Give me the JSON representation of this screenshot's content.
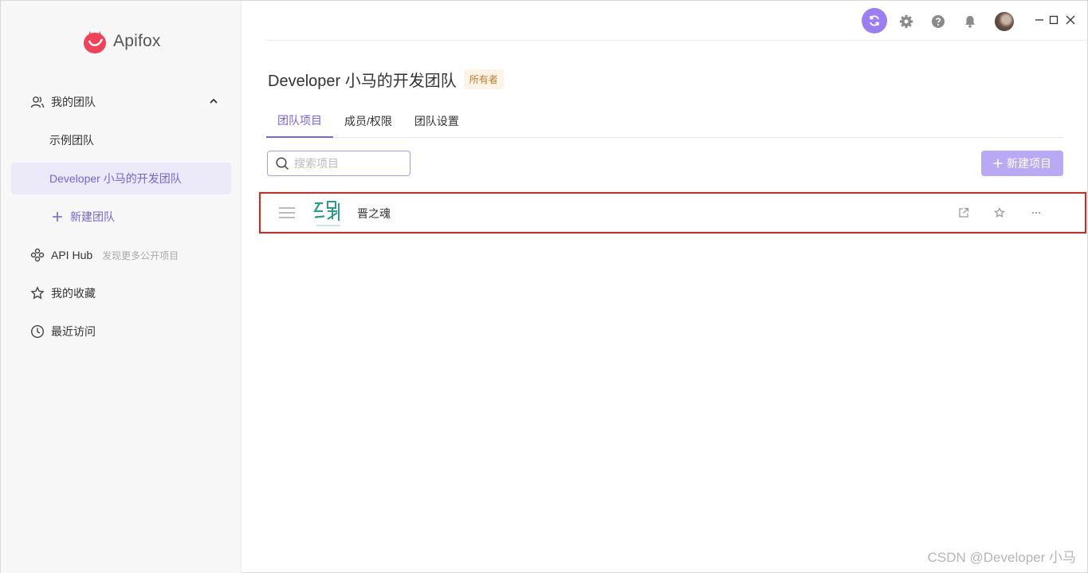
{
  "app": {
    "name": "Apifox"
  },
  "sidebar": {
    "items": [
      {
        "label": "我的团队"
      },
      {
        "label": "示例团队"
      },
      {
        "label": "Developer 小马的开发团队"
      },
      {
        "label": "新建团队"
      },
      {
        "label": "API Hub",
        "hint": "发现更多公开项目"
      },
      {
        "label": "我的收藏"
      },
      {
        "label": "最近访问"
      }
    ]
  },
  "header": {
    "team_title": "Developer 小马的开发团队",
    "role_badge": "所有者"
  },
  "tabs": [
    {
      "label": "团队项目"
    },
    {
      "label": "成员/权限"
    },
    {
      "label": "团队设置"
    }
  ],
  "search": {
    "placeholder": "搜索项目"
  },
  "new_project_button": "新建项目",
  "projects": [
    {
      "name": "晋之魂"
    }
  ],
  "watermark": "CSDN @Developer 小马",
  "colors": {
    "accent": "#7a62d9",
    "highlight_border": "#e0231a"
  }
}
